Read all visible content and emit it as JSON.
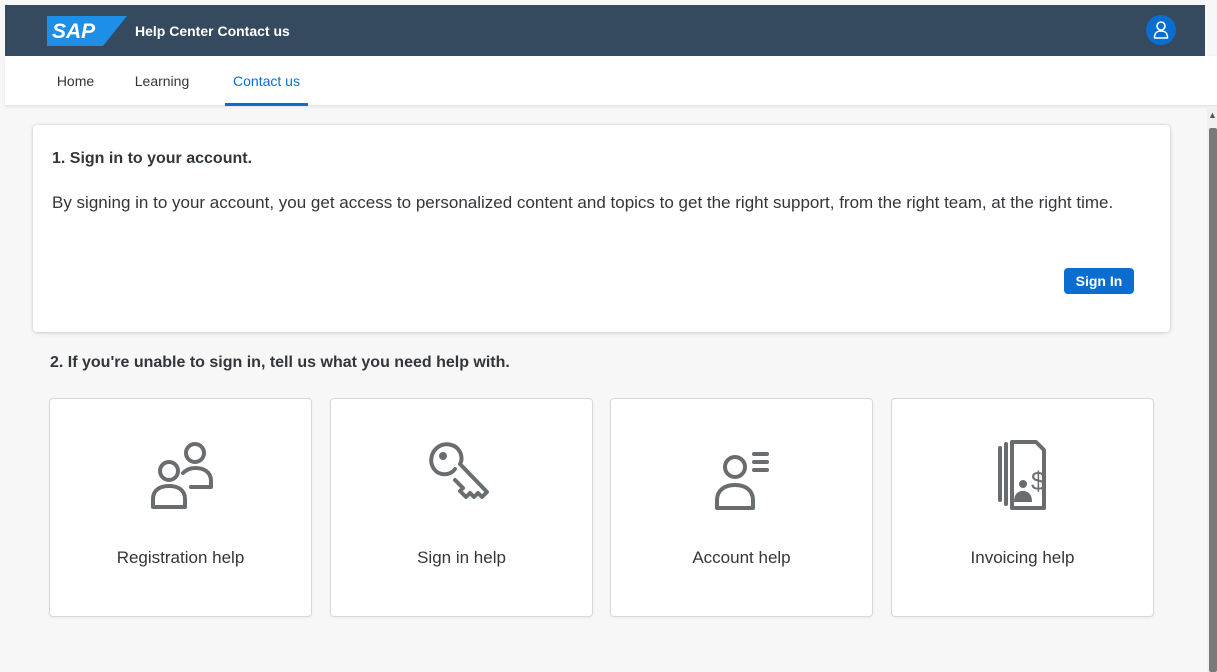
{
  "shell": {
    "logo_text": "SAP",
    "title": "Help Center Contact us",
    "avatar_icon": "user-icon"
  },
  "tabs": [
    {
      "label": "Home"
    },
    {
      "label": "Learning"
    },
    {
      "label": "Contact us",
      "active": true
    }
  ],
  "signin": {
    "heading": "1. Sign in to your account.",
    "text": "By signing in to your account, you get access to personalized content and topics to get the right support, from the right team, at the right time.",
    "button_label": "Sign In"
  },
  "help": {
    "heading": "2. If you're unable to sign in, tell us what you need help with.",
    "tiles": [
      {
        "label": "Registration help",
        "icon": "group-icon"
      },
      {
        "label": "Sign in help",
        "icon": "key-icon"
      },
      {
        "label": "Account help",
        "icon": "user-list-icon"
      },
      {
        "label": "Invoicing help",
        "icon": "invoice-icon"
      }
    ]
  },
  "colors": {
    "shell_bg": "#354a5f",
    "accent": "#0a6ed1",
    "icon_gray": "#6a6d70"
  }
}
